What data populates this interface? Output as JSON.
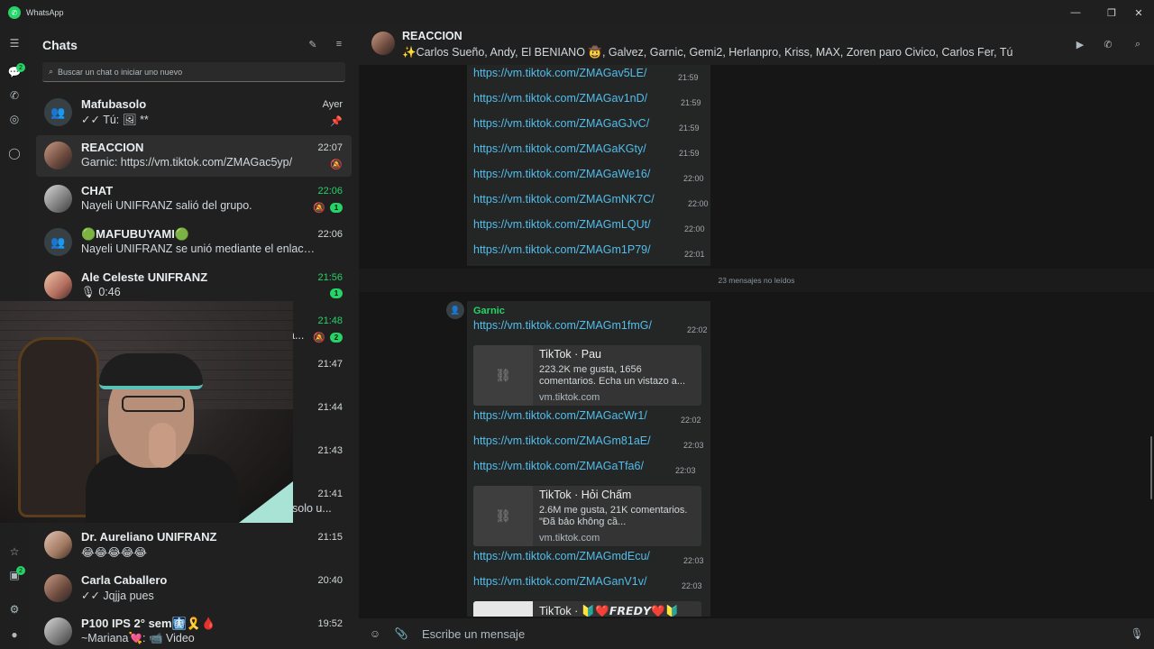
{
  "window": {
    "title": "WhatsApp",
    "controls": [
      "—",
      "❐",
      "✕"
    ]
  },
  "rail": {
    "icons": [
      "menu-icon",
      "chats-icon",
      "calls-icon",
      "status-icon",
      "meta-ai-icon",
      "starred-icon",
      "archived-icon",
      "settings-icon",
      "profile-icon"
    ],
    "chats_badge": "2",
    "archived_badge": "2"
  },
  "panel": {
    "title": "Chats",
    "search_placeholder": "Buscar un chat o iniciar uno nuevo",
    "chats": [
      {
        "name": "Mafubasolo",
        "message": "✓✓ Tú: 🖼 **",
        "time": "Ayer",
        "pinned": true
      },
      {
        "name": "REACCION",
        "message": "Garnic: https://vm.tiktok.com/ZMAGac5yp/",
        "time": "22:07",
        "muted": true,
        "active": true
      },
      {
        "name": "CHAT",
        "message": "Nayeli UNIFRANZ salió del grupo.",
        "time": "22:06",
        "muted": true,
        "unread": "1"
      },
      {
        "name": "🟢MAFUBUYAMI🟢",
        "message": "Nayeli UNIFRANZ se unió mediante el enlace...",
        "time": "22:06"
      },
      {
        "name": "Ale Celeste UNIFRANZ",
        "message": "🎙 0:46",
        "time": "21:56",
        "unread": "1"
      },
      {
        "name": "",
        "message": "a...",
        "time": "21:48",
        "muted": true,
        "unread": "2"
      },
      {
        "name": "",
        "message": "",
        "time": "21:47"
      },
      {
        "name": "",
        "message": "",
        "time": "21:44"
      },
      {
        "name": "",
        "message": "",
        "time": "21:43"
      },
      {
        "name": "",
        "message": "solo u...",
        "time": "21:41"
      },
      {
        "name": "Dr. Aureliano UNIFRANZ",
        "message": "😂😂😂😂😂",
        "time": "21:15"
      },
      {
        "name": "Carla Caballero",
        "message": "✓✓ Jqjja pues",
        "time": "20:40"
      },
      {
        "name": "P100 IPS 2° sem🩻🎗️🩸",
        "message": "~Mariana💘: 📹 Video",
        "time": "19:52"
      }
    ]
  },
  "conversation": {
    "title": "REACCION",
    "members": "✨Carlos Sueño, Andy, El BENIANO 🤠, Galvez, Garnic, Gemi2, Herlanpro, Kriss, MAX, Zoren paro Civico,     Carlos Fer, Tú",
    "unread_divider": "23 mensajes no leídos",
    "sender": "Garnic",
    "messages_before": [
      {
        "link": "https://vm.tiktok.com/ZMAGav5LE/",
        "time": "21:59"
      },
      {
        "link": "https://vm.tiktok.com/ZMAGav1nD/",
        "time": "21:59"
      },
      {
        "link": "https://vm.tiktok.com/ZMAGaGJvC/",
        "time": "21:59"
      },
      {
        "link": "https://vm.tiktok.com/ZMAGaKGty/",
        "time": "21:59"
      },
      {
        "link": "https://vm.tiktok.com/ZMAGaWe16/",
        "time": "22:00"
      },
      {
        "link": "https://vm.tiktok.com/ZMAGmNK7C/",
        "time": "22:00"
      },
      {
        "link": "https://vm.tiktok.com/ZMAGmLQUt/",
        "time": "22:00"
      },
      {
        "link": "https://vm.tiktok.com/ZMAGm1P79/",
        "time": "22:01"
      }
    ],
    "messages_after": [
      {
        "link": "https://vm.tiktok.com/ZMAGm1fmG/",
        "time": "22:02"
      },
      {
        "preview_title": "TikTok · Pau",
        "preview_desc": "223.2K me gusta, 1656 comentarios. Echa un vistazo a...",
        "preview_url": "vm.tiktok.com"
      },
      {
        "link": "https://vm.tiktok.com/ZMAGacWr1/",
        "time": "22:02"
      },
      {
        "link": "https://vm.tiktok.com/ZMAGm81aE/",
        "time": "22:03"
      },
      {
        "link": "https://vm.tiktok.com/ZMAGaTfa6/",
        "time": "22:03"
      },
      {
        "preview_title": "TikTok · Hỏi Chấm",
        "preview_desc": "2.6M me gusta, 21K comentarios. \"Đã bảo không cầ...",
        "preview_url": "vm.tiktok.com"
      },
      {
        "link": "https://vm.tiktok.com/ZMAGmdEcu/",
        "time": "22:03"
      },
      {
        "link": "https://vm.tiktok.com/ZMAGanV1v/",
        "time": "22:03"
      },
      {
        "preview_title": "TikTok · 🔰❤️𝙁𝙍𝙀𝘿𝙔❤️🔰"
      }
    ],
    "composer_placeholder": "Escribe un mensaje"
  },
  "colors": {
    "accent": "#25d366",
    "link": "#53bdeb",
    "bg": "#161616",
    "panel": "#202020"
  }
}
